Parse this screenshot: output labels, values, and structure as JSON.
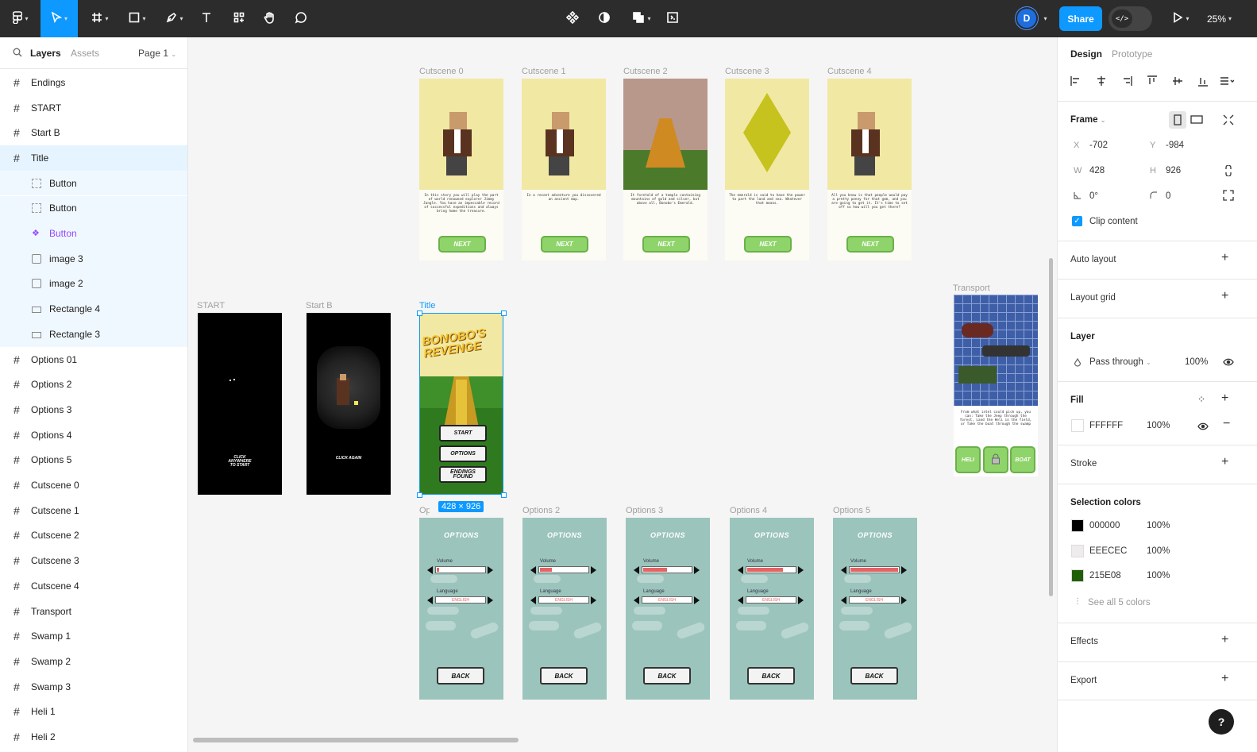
{
  "toolbar": {
    "avatar_initial": "D",
    "share_label": "Share",
    "dev_icon": "</>",
    "zoom_label": "25%"
  },
  "left_panel": {
    "tab_layers": "Layers",
    "tab_assets": "Assets",
    "page_label": "Page 1",
    "layers": [
      {
        "name": "Endings"
      },
      {
        "name": "START"
      },
      {
        "name": "Start B"
      },
      {
        "name": "Title"
      },
      {
        "name": "Button"
      },
      {
        "name": "Button"
      },
      {
        "name": "Button"
      },
      {
        "name": "image 3"
      },
      {
        "name": "image 2"
      },
      {
        "name": "Rectangle 4"
      },
      {
        "name": "Rectangle 3"
      },
      {
        "name": "Options 01"
      },
      {
        "name": "Options 2"
      },
      {
        "name": "Options 3"
      },
      {
        "name": "Options 4"
      },
      {
        "name": "Options 5"
      },
      {
        "name": "Cutscene 0"
      },
      {
        "name": "Cutscene 1"
      },
      {
        "name": "Cutscene 2"
      },
      {
        "name": "Cutscene 3"
      },
      {
        "name": "Cutscene 4"
      },
      {
        "name": "Transport"
      },
      {
        "name": "Swamp 1"
      },
      {
        "name": "Swamp 2"
      },
      {
        "name": "Swamp 3"
      },
      {
        "name": "Heli 1"
      },
      {
        "name": "Heli 2"
      }
    ]
  },
  "canvas": {
    "cutscenes": [
      {
        "label": "Cutscene 0",
        "text": "In this story you will play the part of world renowned explorer Jimmy Jangle. You have an impeccable record of successful expeditions and always bring home the treasure.",
        "button": "NEXT"
      },
      {
        "label": "Cutscene 1",
        "text": "In a recent adventure you discovered an ancient map.",
        "button": "NEXT"
      },
      {
        "label": "Cutscene 2",
        "text": "It foretold of a temple containing mountains of gold and silver, but above all, Bonobo's Emerald.",
        "button": "NEXT"
      },
      {
        "label": "Cutscene 3",
        "text": "The emerald is said to have the power to part the land and sea. Whatever that means.",
        "button": "NEXT"
      },
      {
        "label": "Cutscene 4",
        "text": "All you know is that people would pay a pretty penny for that gem, and you are going to get it. It's time to set off so how will you get there?",
        "button": "NEXT"
      }
    ],
    "start_label": "START",
    "start_text": "CLICK ANYWHERE TO START",
    "startb_label": "Start B",
    "startb_text": "CLICK AGAIN",
    "title_label": "Title",
    "title_logo": "BONOBO'S REVENGE",
    "title_buttons": [
      "START",
      "OPTIONS",
      "ENDINGS FOUND"
    ],
    "selection_dims": "428 × 926",
    "options": [
      {
        "label": "Options 01",
        "volume": 0.05
      },
      {
        "label": "Options 2",
        "volume": 0.25
      },
      {
        "label": "Options 3",
        "volume": 0.5
      },
      {
        "label": "Options 4",
        "volume": 0.75
      },
      {
        "label": "Options 5",
        "volume": 1.0
      }
    ],
    "options_title": "OPTIONS",
    "volume_label": "Volume",
    "language_label": "Language",
    "language_value": "ENGLISH",
    "back_label": "BACK",
    "transport_label": "Transport",
    "transport_text": "From what intel could pick up, you can: Take the Jeep through the forest, Land the Heli in the field, or Take the boat through the swamp",
    "transport_buttons": [
      "HELI",
      "",
      "BOAT"
    ]
  },
  "right_panel": {
    "tab_design": "Design",
    "tab_prototype": "Prototype",
    "frame_label": "Frame",
    "x_label": "X",
    "x_value": "-702",
    "y_label": "Y",
    "y_value": "-984",
    "w_label": "W",
    "w_value": "428",
    "h_label": "H",
    "h_value": "926",
    "rotation_value": "0°",
    "radius_value": "0",
    "clip_label": "Clip content",
    "auto_layout": "Auto layout",
    "layout_grid": "Layout grid",
    "layer_title": "Layer",
    "blend_mode": "Pass through",
    "layer_opacity": "100%",
    "fill_title": "Fill",
    "fill_hex": "FFFFFF",
    "fill_opacity": "100%",
    "stroke_title": "Stroke",
    "selection_colors_title": "Selection colors",
    "selection_colors": [
      {
        "hex": "000000",
        "opacity": "100%",
        "color": "#000000"
      },
      {
        "hex": "EEECEC",
        "opacity": "100%",
        "color": "#EEECEC"
      },
      {
        "hex": "215E08",
        "opacity": "100%",
        "color": "#215E08"
      }
    ],
    "see_all": "See all 5 colors",
    "effects": "Effects",
    "export": "Export",
    "help": "?"
  }
}
